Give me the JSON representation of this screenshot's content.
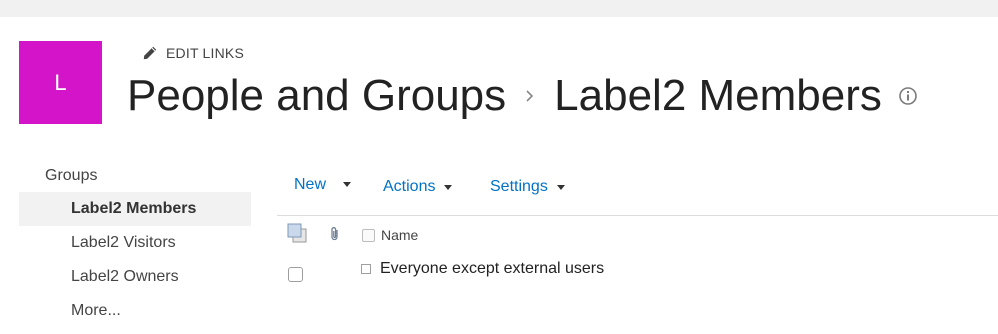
{
  "site": {
    "logo_letter": "L",
    "logo_color": "#d414c8",
    "edit_links_label": "EDIT LINKS",
    "breadcrumb": [
      "People and Groups",
      "Label2 Members"
    ]
  },
  "quicklaunch": {
    "header": "Groups",
    "items": [
      {
        "label": "Label2 Members",
        "selected": true
      },
      {
        "label": "Label2 Visitors",
        "selected": false
      },
      {
        "label": "Label2 Owners",
        "selected": false
      },
      {
        "label": "More...",
        "selected": false
      }
    ]
  },
  "commands": {
    "new_label": "New",
    "actions_label": "Actions",
    "settings_label": "Settings"
  },
  "list": {
    "columns": {
      "name": "Name"
    },
    "rows": [
      {
        "name": "Everyone except external users"
      }
    ]
  },
  "colors": {
    "link": "#0072c6",
    "selected_bg": "#f2f2f2"
  },
  "icons": [
    "pencil-icon",
    "breadcrumb-chevron-icon",
    "info-icon",
    "select-all-icon",
    "attachment-icon"
  ]
}
